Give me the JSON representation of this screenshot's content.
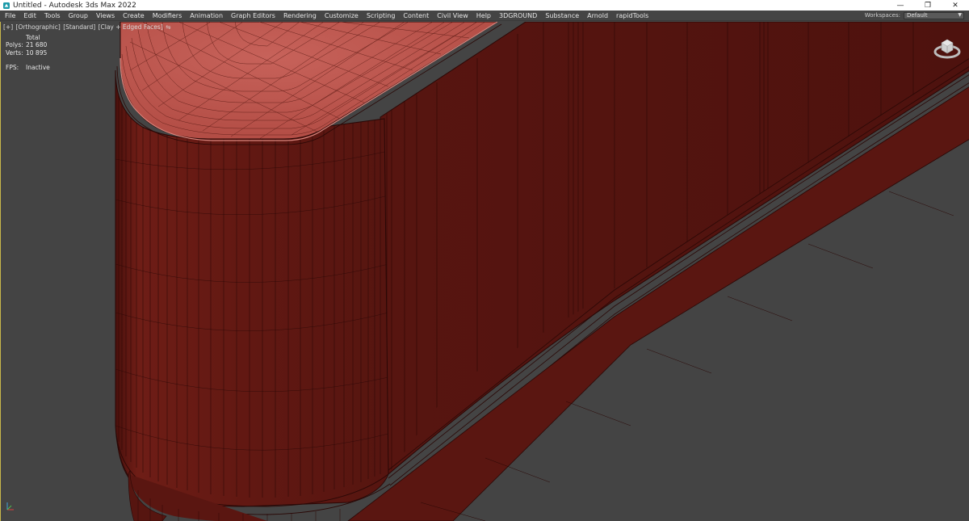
{
  "window": {
    "title": "Untitled - Autodesk 3ds Max 2022",
    "icon": "3dsmax-logo-icon",
    "controls": [
      "minimize-icon",
      "restore-icon",
      "close-icon"
    ]
  },
  "menu": {
    "items": [
      "File",
      "Edit",
      "Tools",
      "Group",
      "Views",
      "Create",
      "Modifiers",
      "Animation",
      "Graph Editors",
      "Rendering",
      "Customize",
      "Scripting",
      "Content",
      "Civil View",
      "Help",
      "3DGROUND",
      "Substance",
      "Arnold",
      "rapidTools"
    ],
    "workspaces_label": "Workspaces:",
    "workspace_value": "Default"
  },
  "viewport": {
    "label_parts": [
      "[+]",
      "[Orthographic]",
      "[Standard]",
      "[Clay + Edged Faces]"
    ],
    "stats": {
      "header": "Total",
      "polys_label": "Polys:",
      "polys_value": "21 680",
      "verts_label": "Verts:",
      "verts_value": "10 895",
      "fps_label": "FPS:",
      "fps_value": "Inactive"
    },
    "colors": {
      "background": "#444444",
      "mesh_side": "#5c1712",
      "mesh_top": "#c0574e",
      "wire": "#2a0806",
      "border_active": "#c8b74a"
    }
  }
}
